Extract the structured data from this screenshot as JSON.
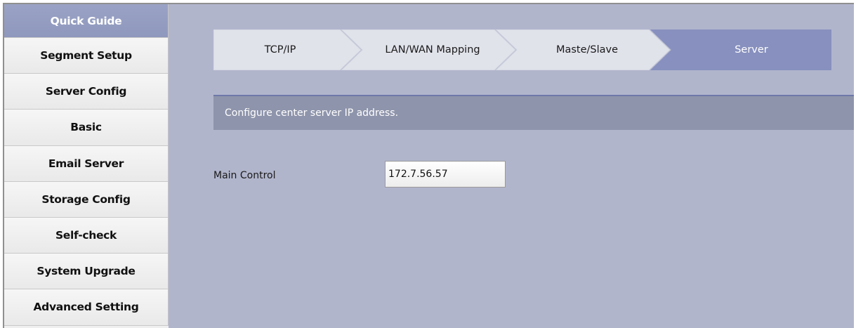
{
  "sidebar": {
    "items": [
      {
        "label": "Quick Guide",
        "active": true
      },
      {
        "label": "Segment Setup",
        "active": false
      },
      {
        "label": "Server Config",
        "active": false
      },
      {
        "label": "Basic",
        "active": false
      },
      {
        "label": "Email Server",
        "active": false
      },
      {
        "label": "Storage Config",
        "active": false
      },
      {
        "label": "Self-check",
        "active": false
      },
      {
        "label": "System Upgrade",
        "active": false
      },
      {
        "label": "Advanced Setting",
        "active": false
      }
    ]
  },
  "wizard": {
    "steps": [
      {
        "label": "TCP/IP",
        "active": false
      },
      {
        "label": "LAN/WAN Mapping",
        "active": false
      },
      {
        "label": "Maste/Slave",
        "active": false
      },
      {
        "label": "Server",
        "active": true
      }
    ]
  },
  "banner": {
    "text": "Configure center server IP address."
  },
  "form": {
    "main_control_label": "Main Control",
    "main_control_value": "172.7.56.57"
  },
  "colors": {
    "background": "#b1b5cc",
    "active_step": "#8790be",
    "inactive_step": "#e1e3eb",
    "banner": "#8e94ab",
    "sidebar_active": "#949dc1"
  }
}
